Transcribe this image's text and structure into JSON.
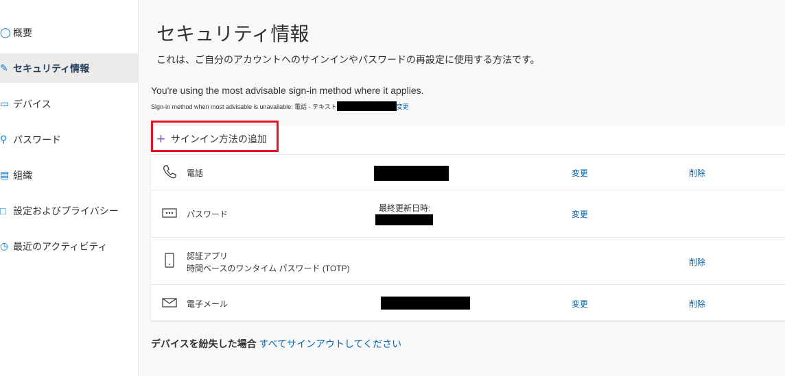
{
  "sidebar": {
    "items": [
      {
        "label": "概要",
        "icon": "person-icon"
      },
      {
        "label": "セキュリティ情報",
        "icon": "person-edit-icon",
        "active": true
      },
      {
        "label": "デバイス",
        "icon": "laptop-icon"
      },
      {
        "label": "パスワード",
        "icon": "key-icon"
      },
      {
        "label": "組織",
        "icon": "briefcase-icon"
      },
      {
        "label": "設定およびプライバシー",
        "icon": "lock-icon"
      },
      {
        "label": "最近のアクティビティ",
        "icon": "clock-icon"
      }
    ]
  },
  "main": {
    "title": "セキュリティ情報",
    "subtitle": "これは、ご自分のアカウントへのサインインやパスワードの再設定に使用する方法です。",
    "advisable": "You're using the most advisable sign-in method where it applies.",
    "fallback_label": "Sign-in method when most advisable is unavailable: 電話 - テキスト",
    "fallback_change": "変更",
    "add_method": "サインイン方法の追加",
    "methods": [
      {
        "name": "電話",
        "icon": "phone-icon",
        "change": "変更",
        "delete": "削除"
      },
      {
        "name": "パスワード",
        "icon": "password-icon",
        "value_label": "最終更新日時:",
        "change": "変更"
      },
      {
        "name": "認証アプリ",
        "detail": "時間ベースのワンタイム パスワード (TOTP)",
        "icon": "mobile-icon",
        "delete": "削除"
      },
      {
        "name": "電子メール",
        "icon": "mail-icon",
        "change": "変更",
        "delete": "削除"
      }
    ],
    "lost_label": "デバイスを紛失した場合",
    "lost_link": "すべてサインアウトしてください"
  },
  "colors": {
    "accent": "#0067b8",
    "highlight_box": "#e81123",
    "plus": "#8764b8"
  }
}
